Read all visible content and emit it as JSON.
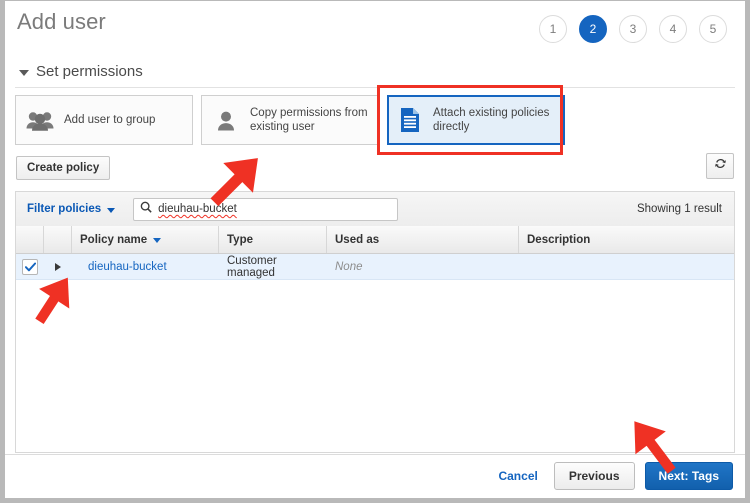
{
  "page": {
    "title": "Add user"
  },
  "steps": {
    "items": [
      "1",
      "2",
      "3",
      "4",
      "5"
    ],
    "active_index": 1,
    "active_color": "#1565c0"
  },
  "section": {
    "title": "Set permissions"
  },
  "permission_options": [
    {
      "label": "Add user to group",
      "icon": "user-group-icon",
      "selected": false
    },
    {
      "label": "Copy permissions from existing user",
      "icon": "user-icon",
      "selected": false
    },
    {
      "label": "Attach existing policies directly",
      "icon": "document-icon",
      "selected": true
    }
  ],
  "toolbar": {
    "create_policy_label": "Create policy",
    "refresh_icon": "refresh-icon"
  },
  "filter_bar": {
    "filter_label": "Filter policies",
    "search_icon": "search-icon",
    "search_value": "dieuhau-bucket",
    "search_placeholder": "Search",
    "result_count_text": "Showing 1 result"
  },
  "table": {
    "columns": [
      "",
      "",
      "Policy name",
      "Type",
      "Used as",
      "Description"
    ],
    "sorted_column": "Policy name",
    "rows": [
      {
        "checked": true,
        "expand_icon": "chevron-right-icon",
        "policy_name": "dieuhau-bucket",
        "type": "Customer managed",
        "used_as": "None",
        "description": ""
      }
    ]
  },
  "footer": {
    "cancel_label": "Cancel",
    "previous_label": "Previous",
    "next_label": "Next: Tags"
  },
  "annotations": {
    "highlight_color": "#ef3124",
    "arrows": [
      "arrow-to-search-field",
      "arrow-to-row-checkbox",
      "arrow-to-next-button"
    ],
    "box_target": "Attach existing policies directly"
  }
}
